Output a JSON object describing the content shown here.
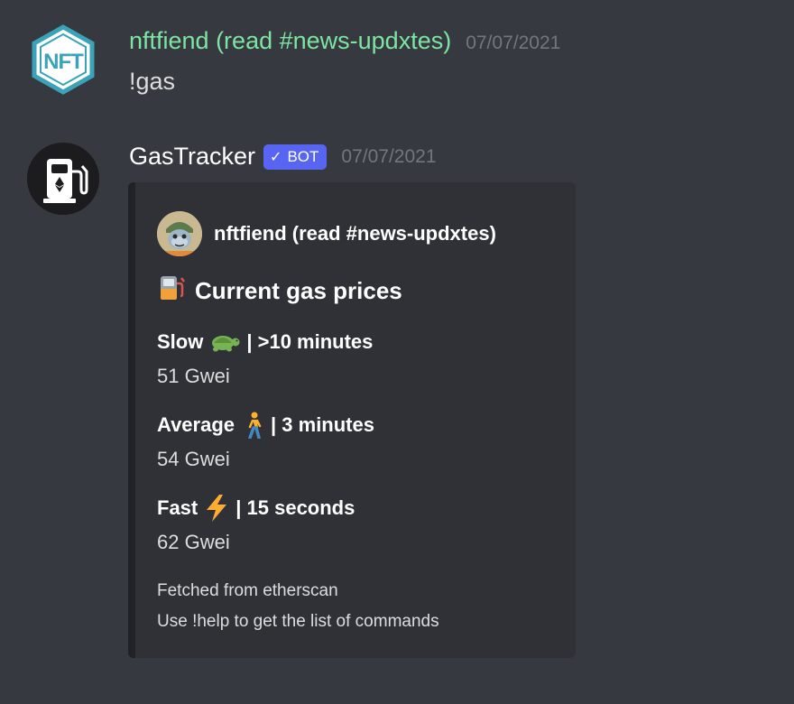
{
  "messages": [
    {
      "username": "nftfiend (read #news-updxtes)",
      "timestamp": "07/07/2021",
      "content": "!gas",
      "avatar_icon": "nft-hexagon-logo-icon",
      "avatar_text": "NFT"
    },
    {
      "username": "GasTracker",
      "badge": "BOT",
      "timestamp": "07/07/2021",
      "avatar_icon": "gas-pump-ethereum-icon",
      "embed": {
        "author_name": "nftfiend (read #news-updxtes)",
        "author_avatar_icon": "monkey-avatar-icon",
        "title_icon": "fuel-pump-emoji-icon",
        "title": "Current gas prices",
        "fields": [
          {
            "label": "Slow",
            "emoji": "turtle-emoji-icon",
            "suffix": "| >10 minutes",
            "value": "51 Gwei"
          },
          {
            "label": "Average",
            "emoji": "person-walking-emoji-icon",
            "suffix": "| 3 minutes",
            "value": "54 Gwei"
          },
          {
            "label": "Fast",
            "emoji": "lightning-emoji-icon",
            "suffix": "| 15 seconds",
            "value": "62 Gwei"
          }
        ],
        "footer_lines": [
          "Fetched from etherscan",
          "Use !help to get the list of commands"
        ]
      }
    }
  ],
  "colors": {
    "background": "#36393f",
    "embed_background": "#2f3136",
    "embed_bar": "#202225",
    "username_1": "#7ee4a4",
    "timestamp": "#72767d",
    "bot_badge": "#5865f2"
  }
}
